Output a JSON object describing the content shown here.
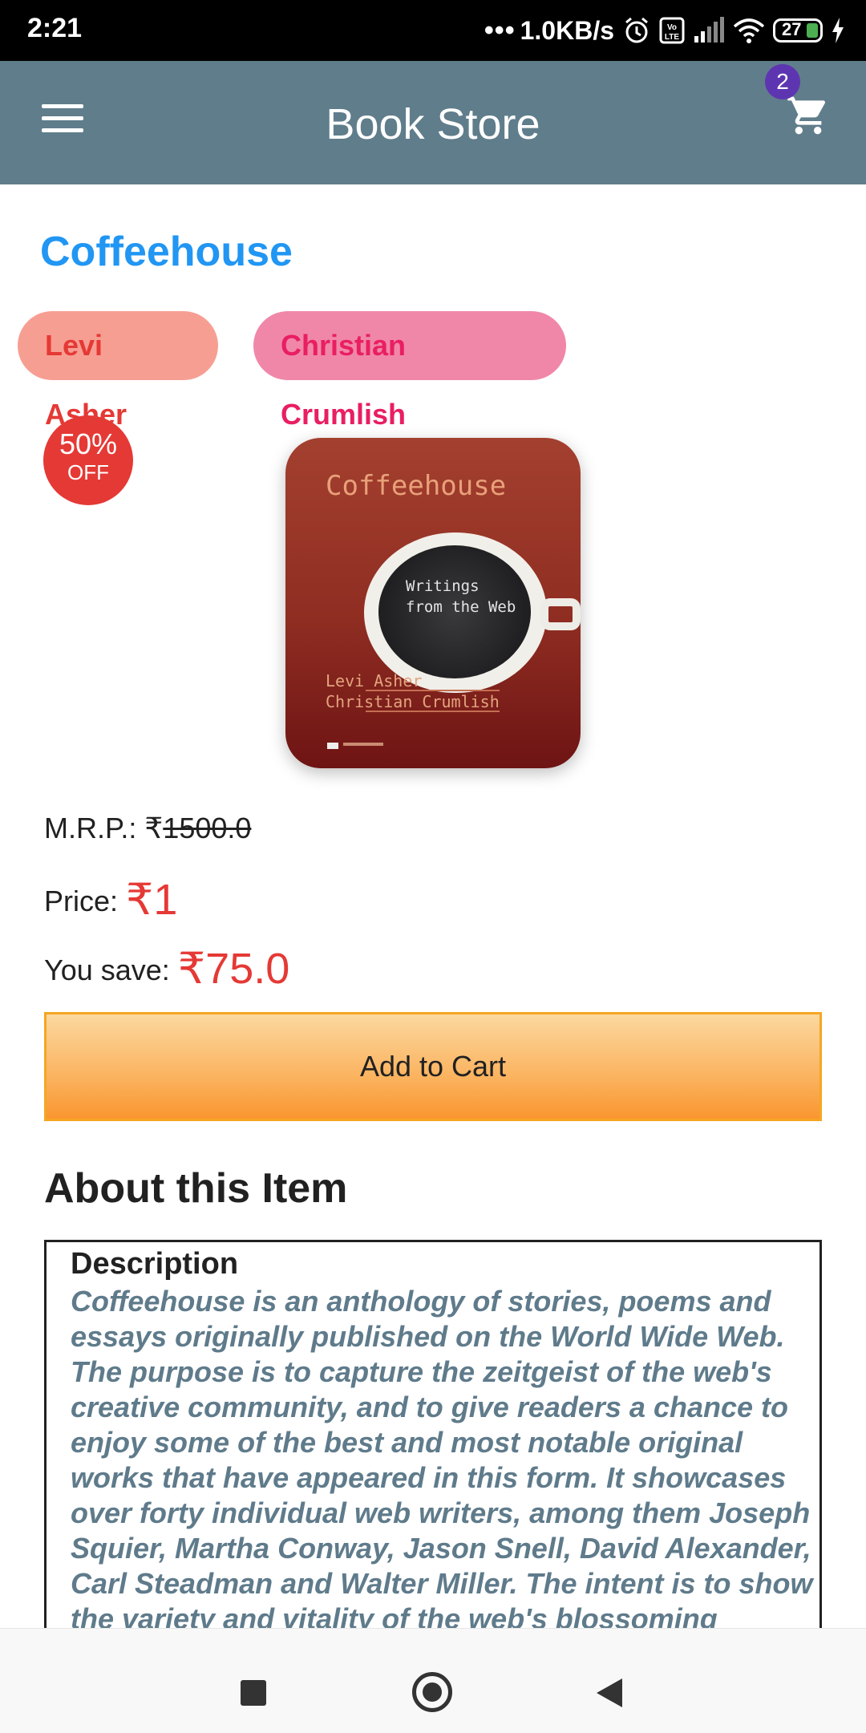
{
  "status_bar": {
    "time": "2:21",
    "network_speed": "1.0KB/s",
    "battery_level": "27",
    "icons": [
      "alarm-icon",
      "volte-icon",
      "signal-icon",
      "wifi-icon",
      "battery-icon",
      "charging-icon"
    ]
  },
  "app_bar": {
    "title": "Book Store",
    "cart_count": "2",
    "menu_icon": "hamburger-menu-icon",
    "cart_icon": "shopping-cart-icon",
    "color": "#607d8b"
  },
  "book": {
    "title": "Coffeehouse",
    "authors": [
      "Levi Asher",
      "Christian Crumlish"
    ],
    "discount_percent": "50%",
    "discount_label": "OFF",
    "cover": {
      "title": "Coffeehouse",
      "subtitle_line1": "Writings",
      "subtitle_line2": "from the Web",
      "author1": "Levi Asher",
      "author2": "Christian Crumlish"
    },
    "mrp_label": "M.R.P.:",
    "mrp_currency": "₹",
    "mrp_value": "1500.0",
    "price_label": "Price:",
    "price_value": "₹1",
    "save_label": "You save:",
    "save_value": "₹75.0"
  },
  "actions": {
    "add_to_cart": "Add to Cart"
  },
  "about": {
    "heading": "About this Item",
    "description_label": "Description",
    "description": "Coffeehouse is an anthology of stories, poems and essays originally published on the World Wide Web. The purpose is to capture the zeitgeist of the web's creative community, and to give readers a chance to enjoy some of the best and most notable original works that have appeared in this form. It showcases over forty individual web writers, among them Joseph Squier, Martha Conway, Jason Snell, David Alexander, Carl Steadman and Walter Miller. The intent is to show the variety and vitality of the web's blossoming literary"
  },
  "colors": {
    "title_blue": "#2196f3",
    "price_red": "#e53935",
    "button_orange": "#fbb35f",
    "chip1_bg": "#f79e93",
    "chip2_bg": "#f087a9",
    "badge_purple": "#5e35b1"
  },
  "nav_bar": {
    "icons": [
      "recent-apps-icon",
      "home-icon",
      "back-icon"
    ]
  }
}
